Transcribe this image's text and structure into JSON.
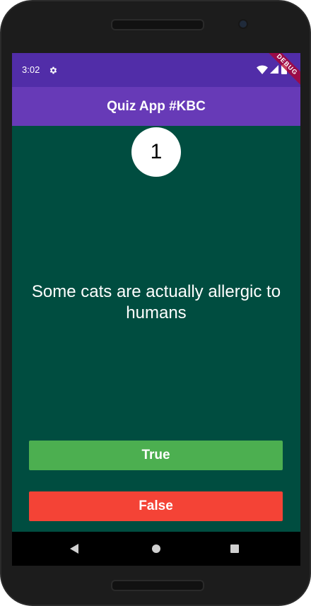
{
  "status_bar": {
    "time": "3:02",
    "icons": [
      "settings-icon",
      "wifi-icon",
      "signal-icon",
      "battery-icon"
    ],
    "debug_banner": "DEBUG"
  },
  "app_bar": {
    "title": "Quiz App #KBC"
  },
  "quiz": {
    "question_number": "1",
    "question": "Some cats are actually allergic to humans",
    "true_label": "True",
    "false_label": "False"
  },
  "nav_bar": {
    "icons": [
      "back-icon",
      "home-icon",
      "recent-apps-icon"
    ]
  },
  "colors": {
    "status_bar": "#512da8",
    "app_bar": "#673ab7",
    "background": "#004d40",
    "true_button": "#4caf50",
    "false_button": "#f44336"
  }
}
